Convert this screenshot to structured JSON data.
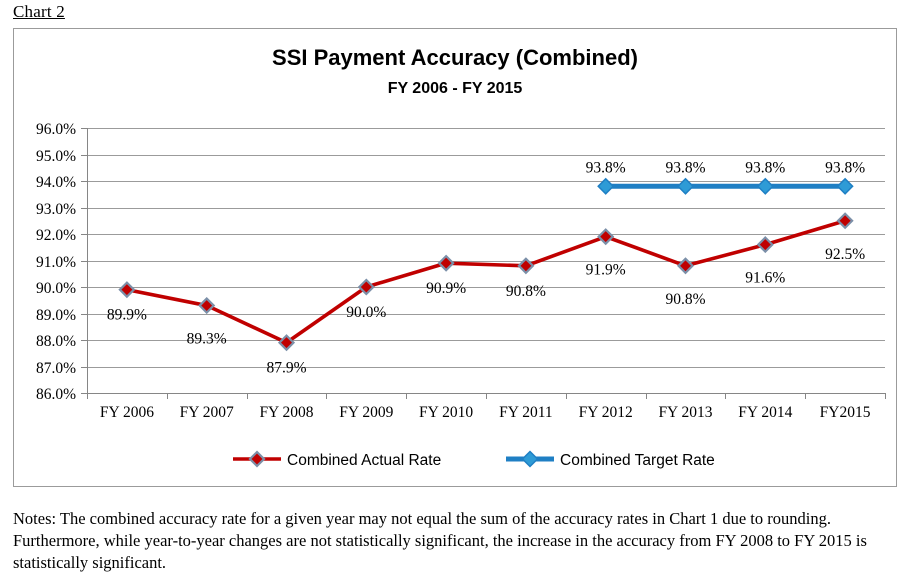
{
  "caption": "Chart 2",
  "notes": "Notes: The combined accuracy rate for a given year may not equal the sum of the accuracy rates in Chart 1 due to rounding.  Furthermore, while year-to-year changes are not statistically significant, the increase in the accuracy from FY 2008 to FY 2015 is statistically significant.",
  "colors": {
    "actual_line": "#C00000",
    "actual_marker_fill": "#C00000",
    "actual_marker_stroke": "#7B8FA8",
    "target_line": "#1F7FC4",
    "target_marker_fill": "#2E9BD6",
    "gridline": "#9b9b9b",
    "border": "#9b9b9b",
    "text": "#000000"
  },
  "chart_data": {
    "type": "line",
    "title": "SSI Payment Accuracy (Combined)",
    "subtitle": "FY 2006 - FY 2015",
    "xlabel": "",
    "ylabel": "",
    "grid": true,
    "legend_position": "bottom",
    "ylim": [
      86.0,
      96.0
    ],
    "ytick_step": 1.0,
    "ytick_labels": [
      "96.0%",
      "95.0%",
      "94.0%",
      "93.0%",
      "92.0%",
      "91.0%",
      "90.0%",
      "89.0%",
      "88.0%",
      "87.0%",
      "86.0%"
    ],
    "ytick_values": [
      96.0,
      95.0,
      94.0,
      93.0,
      92.0,
      91.0,
      90.0,
      89.0,
      88.0,
      87.0,
      86.0
    ],
    "categories": [
      "FY 2006",
      "FY 2007",
      "FY 2008",
      "FY 2009",
      "FY 2010",
      "FY 2011",
      "FY 2012",
      "FY 2013",
      "FY 2014",
      "FY2015"
    ],
    "series": [
      {
        "name": "Combined Actual Rate",
        "color": "#C00000",
        "values": [
          89.9,
          89.3,
          87.9,
          90.0,
          90.9,
          90.8,
          91.9,
          90.8,
          91.6,
          92.5
        ],
        "data_labels": [
          "89.9%",
          "89.3%",
          "87.9%",
          "90.0%",
          "90.9%",
          "90.8%",
          "91.9%",
          "90.8%",
          "91.6%",
          "92.5%"
        ],
        "label_offsets_y": [
          30,
          38,
          30,
          30,
          30,
          30,
          38,
          38,
          38,
          38
        ]
      },
      {
        "name": "Combined Target Rate",
        "color": "#1F7FC4",
        "values": [
          null,
          null,
          null,
          null,
          null,
          null,
          93.8,
          93.8,
          93.8,
          93.8
        ],
        "data_labels": [
          "",
          "",
          "",
          "",
          "",
          "",
          "93.8%",
          "93.8%",
          "93.8%",
          "93.8%"
        ],
        "label_offsets_y": [
          0,
          0,
          0,
          0,
          0,
          0,
          -14,
          -14,
          -14,
          -14
        ]
      }
    ],
    "legend": [
      {
        "label": "Combined Actual Rate",
        "color": "#C00000",
        "marker_stroke": "#7B8FA8"
      },
      {
        "label": "Combined Target Rate",
        "color": "#1F7FC4",
        "marker_stroke": "#2E9BD6"
      }
    ]
  }
}
